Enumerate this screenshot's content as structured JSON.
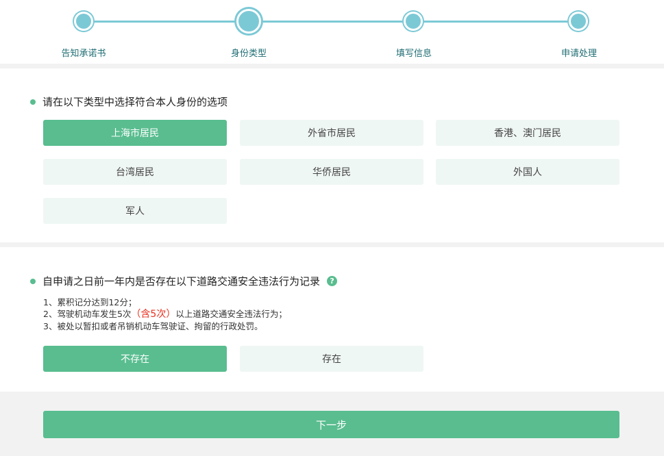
{
  "steps": [
    {
      "label": "告知承诺书",
      "active": false
    },
    {
      "label": "身份类型",
      "active": true
    },
    {
      "label": "填写信息",
      "active": false
    },
    {
      "label": "申请处理",
      "active": false
    }
  ],
  "identity": {
    "title": "请在以下类型中选择符合本人身份的选项",
    "options": [
      "上海市居民",
      "外省市居民",
      "香港、澳门居民",
      "台湾居民",
      "华侨居民",
      "外国人",
      "军人"
    ],
    "selected": "上海市居民"
  },
  "violation": {
    "title": "自申请之日前一年内是否存在以下道路交通安全违法行为记录",
    "help_icon": "?",
    "rule1": "1、累积记分达到12分；",
    "rule2_pre": "2、驾驶机动车发生5次",
    "rule2_red": "（含5次）",
    "rule2_post": "以上道路交通安全违法行为；",
    "rule3": "3、被处以暂扣或者吊销机动车驾驶证、拘留的行政处罚。",
    "options": [
      "不存在",
      "存在"
    ],
    "selected": "不存在"
  },
  "next_button": "下一步",
  "colors": {
    "accent": "#59bd8f",
    "step": "#7cc9d6",
    "option_bg": "#eff7f4",
    "warning": "#e8301f"
  }
}
